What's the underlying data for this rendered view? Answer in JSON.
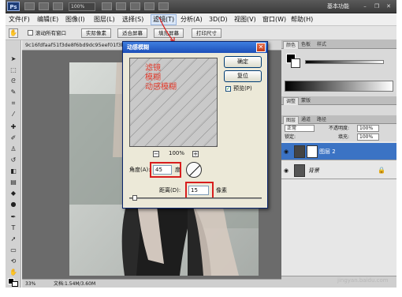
{
  "titlebar": {
    "app_logo": "Ps",
    "zoom": "100%",
    "workspace": "基本功能",
    "minimize": "–",
    "restore": "❐",
    "close": "✕"
  },
  "menubar": {
    "items": [
      "文件(F)",
      "编辑(E)",
      "图像(I)",
      "图层(L)",
      "选择(S)",
      "滤镜(T)",
      "分析(A)",
      "3D(D)",
      "视图(V)",
      "窗口(W)",
      "帮助(H)"
    ]
  },
  "options": {
    "scroll_all": "滚动所有窗口",
    "actual_pixels": "实际像素",
    "fit_screen": "适合屏幕",
    "fill_screen": "填充屏幕",
    "print_size": "打印尺寸"
  },
  "document": {
    "tab_title": "9c16fdfaaf51f3de8f6bd9dc95eef01f3b29...",
    "status_zoom": "33%",
    "status_doc": "文档:1.54M/3.60M"
  },
  "dialog": {
    "title": "动感模糊",
    "ok": "确定",
    "reset": "复位",
    "preview": "预览(P)",
    "zoom": "100%",
    "zoom_out": "−",
    "zoom_in": "+",
    "angle_label": "角度(A):",
    "angle_value": "45",
    "angle_unit": "度",
    "distance_label": "距离(D):",
    "distance_value": "15",
    "distance_unit": "像素"
  },
  "annotation": {
    "line1": "滤镜",
    "line2": "模糊",
    "line3": "动感模糊"
  },
  "panels": {
    "tabs1": [
      "颜色",
      "色板",
      "样式"
    ],
    "tabs2": [
      "调整",
      "蒙版"
    ],
    "tabs3": [
      "图层",
      "通道",
      "路径"
    ],
    "blend_mode": "正常",
    "opacity_label": "不透明度:",
    "opacity": "100%",
    "lock_label": "锁定:",
    "fill_label": "填充:",
    "fill": "100%",
    "layers": [
      {
        "name": "图层 2",
        "selected": true
      },
      {
        "name": "背景",
        "selected": false
      }
    ]
  },
  "watermark": "jingyan.baidu.com",
  "colors": {
    "accent_red": "#d81d1d",
    "annotation_red": "#e23b2c",
    "selection_blue": "#3b73c4",
    "dialog_title_blue": "#1d4fb8"
  }
}
